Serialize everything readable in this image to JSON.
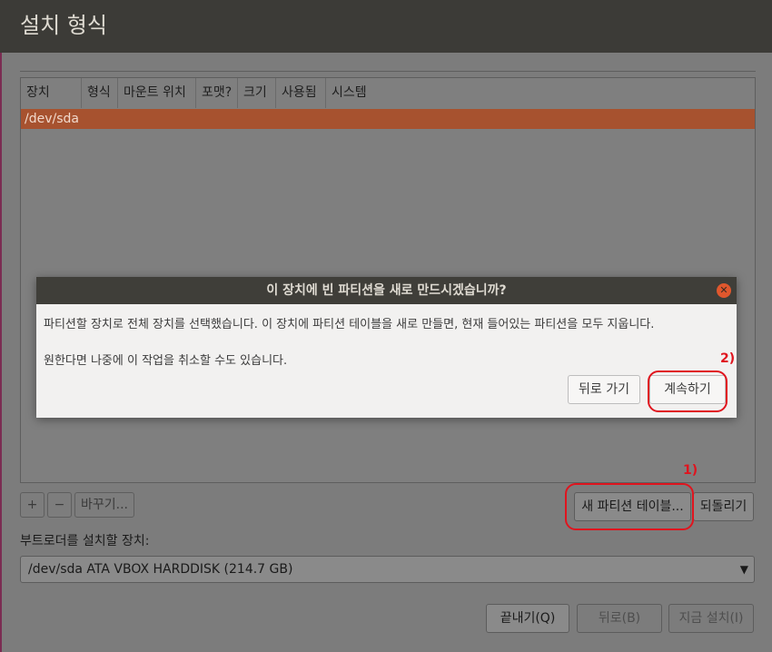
{
  "window": {
    "title": "설치 형식"
  },
  "table": {
    "columns": [
      "장치",
      "형식",
      "마운트 위치",
      "포맷?",
      "크기",
      "사용됨",
      "시스템"
    ],
    "rows": [
      {
        "device": "/dev/sda"
      }
    ]
  },
  "partition_buttons": {
    "add": "+",
    "remove": "−",
    "change": "바꾸기...",
    "new_table": "새 파티션 테이블...",
    "revert": "되돌리기"
  },
  "bootloader": {
    "label": "부트로더를 설치할 장치:",
    "selected": "/dev/sda ATA VBOX HARDDISK (214.7 GB)"
  },
  "footer": {
    "quit": "끝내기(Q)",
    "back": "뒤로(B)",
    "install_now": "지금 설치(I)"
  },
  "dialog": {
    "title": "이 장치에 빈 파티션을 새로 만드시겠습니까?",
    "message1": "파티션할 장치로 전체 장치를 선택했습니다. 이 장치에 파티션 테이블을 새로 만들면, 현재 들어있는 파티션을 모두 지웁니다.",
    "message2": "원한다면 나중에 이 작업을 취소할 수도 있습니다.",
    "back_button": "뒤로 가기",
    "continue_button": "계속하기"
  },
  "annotations": {
    "step1": "1)",
    "step2": "2)"
  },
  "colors": {
    "selected_row": "#a7522f",
    "titlebar": "#3c3b37",
    "annotation_red": "#e0141e",
    "close_button": "#e0572d"
  }
}
